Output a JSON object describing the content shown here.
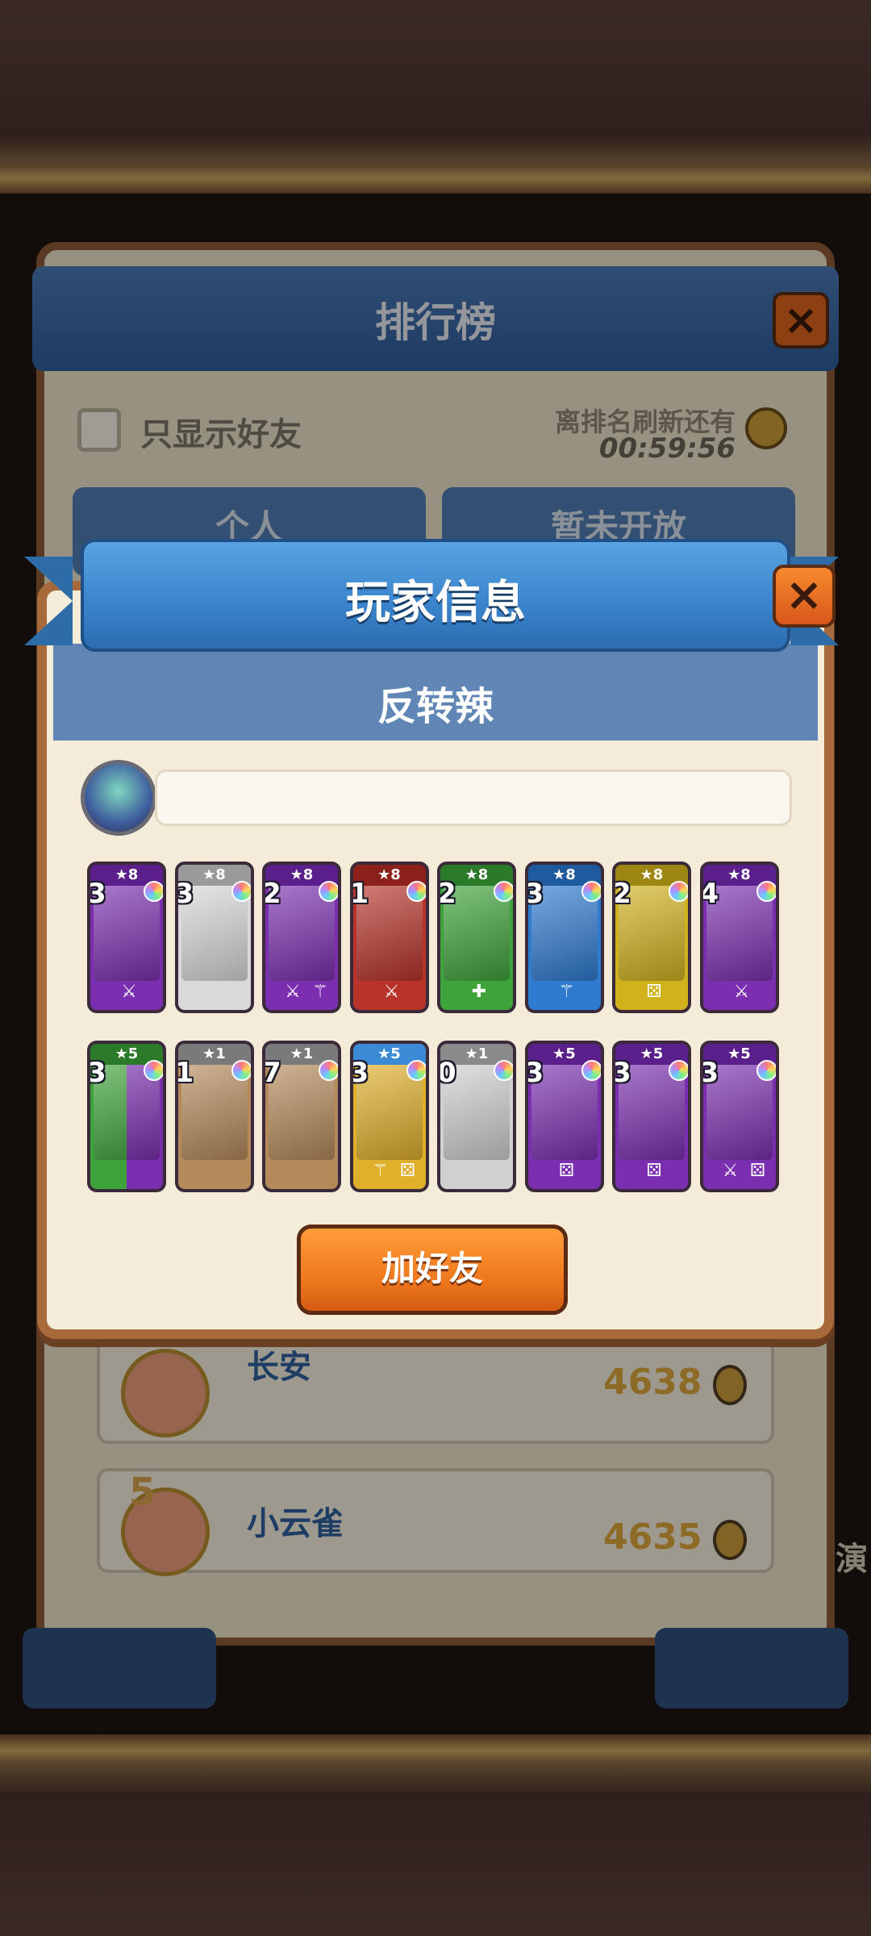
{
  "leaderboard": {
    "title": "排行榜",
    "close_label": "×",
    "only_friends_label": "只显示好友",
    "refresh_label": "离排名刷新还有",
    "refresh_time": "00:59:56",
    "tabs": [
      "个人",
      "暂未开放"
    ],
    "rows": [
      {
        "rank": "",
        "name": "长安",
        "score": "4638"
      },
      {
        "rank": "5",
        "name": "小云雀",
        "score": "4635"
      }
    ],
    "side_fragment": "演"
  },
  "dialog": {
    "title": "玩家信息",
    "close_label": "×",
    "player_name": "反转辣",
    "add_friend_label": "加好友",
    "cards_row1": [
      {
        "stars": "★8",
        "level": "3",
        "color": "purple",
        "icons": [
          "sword"
        ]
      },
      {
        "stars": "★8",
        "level": "3",
        "color": "white",
        "icons": []
      },
      {
        "stars": "★8",
        "level": "2",
        "color": "purple",
        "icons": [
          "sword",
          "staff"
        ]
      },
      {
        "stars": "★8",
        "level": "1",
        "color": "red",
        "icons": [
          "sword"
        ]
      },
      {
        "stars": "★8",
        "level": "2",
        "color": "green",
        "icons": [
          "heal"
        ]
      },
      {
        "stars": "★8",
        "level": "3",
        "color": "blue",
        "icons": [
          "staff"
        ]
      },
      {
        "stars": "★8",
        "level": "2",
        "color": "yellow",
        "icons": [
          "dice"
        ]
      },
      {
        "stars": "★8",
        "level": "4",
        "color": "purple",
        "icons": [
          "sword"
        ]
      }
    ],
    "cards_row2": [
      {
        "stars": "★5",
        "level": "3",
        "color": "greenpurple",
        "icons": []
      },
      {
        "stars": "★1",
        "level": "1",
        "color": "brown",
        "icons": []
      },
      {
        "stars": "★1",
        "level": "7",
        "color": "brown",
        "icons": []
      },
      {
        "stars": "★5",
        "level": "3",
        "color": "gold",
        "icons": [
          "staff",
          "dice"
        ]
      },
      {
        "stars": "★1",
        "level": "0",
        "color": "gray",
        "icons": []
      },
      {
        "stars": "★5",
        "level": "3",
        "color": "purple",
        "icons": [
          "dice"
        ]
      },
      {
        "stars": "★5",
        "level": "3",
        "color": "purple",
        "icons": [
          "dice"
        ]
      },
      {
        "stars": "★5",
        "level": "3",
        "color": "purple",
        "icons": [
          "sword",
          "dice"
        ]
      }
    ]
  },
  "colors": {
    "ribbon": "#3b86cf",
    "add_button": "#f07a1e",
    "dialog_bg": "#f4ecd9",
    "frame": "#a86a3a"
  }
}
